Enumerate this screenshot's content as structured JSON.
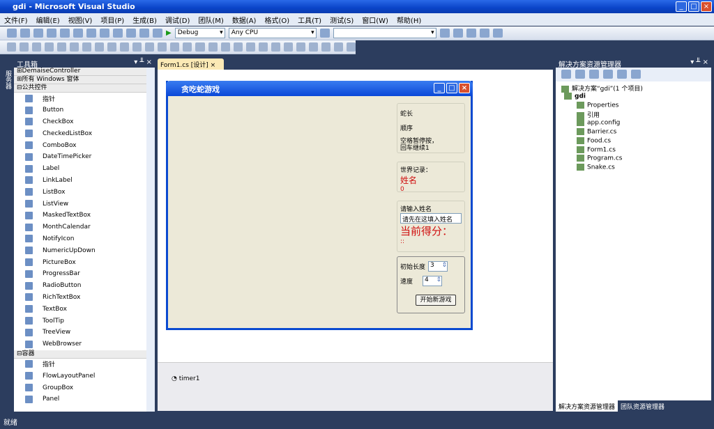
{
  "window": {
    "title": "gdi - Microsoft Visual Studio"
  },
  "menu": [
    "文件(F)",
    "编辑(E)",
    "视图(V)",
    "项目(P)",
    "生成(B)",
    "调试(D)",
    "团队(M)",
    "数据(A)",
    "格式(O)",
    "工具(T)",
    "测试(S)",
    "窗口(W)",
    "帮助(H)"
  ],
  "toolbar": {
    "config": "Debug",
    "platform": "Any CPU",
    "find": ""
  },
  "toolbox": {
    "title": "工具箱",
    "groups_top": [
      "DemaiseController",
      "所有 Windows 窗体",
      "公共控件"
    ],
    "common": [
      "指针",
      "Button",
      "CheckBox",
      "CheckedListBox",
      "ComboBox",
      "DateTimePicker",
      "Label",
      "LinkLabel",
      "ListBox",
      "ListView",
      "MaskedTextBox",
      "MonthCalendar",
      "NotifyIcon",
      "NumericUpDown",
      "PictureBox",
      "ProgressBar",
      "RadioButton",
      "RichTextBox",
      "TextBox",
      "ToolTip",
      "TreeView",
      "WebBrowser"
    ],
    "container_group": "容器",
    "containers": [
      "指针",
      "FlowLayoutPanel",
      "GroupBox",
      "Panel"
    ]
  },
  "leftstrip": "服务器",
  "doc": {
    "tab": "Form1.cs [设计]",
    "close": "×",
    "tray_item": "timer1"
  },
  "form": {
    "title": "贪吃蛇游戏",
    "snake_len": "蛇长",
    "order": "顺序",
    "hint": "空格暂停按，回车继续1",
    "record_label": "世界记录：",
    "record_name": "姓名",
    "record_score": "0",
    "name_prompt": "请输入姓名",
    "name_input": "请先在这填入姓名",
    "score_label": "当前得分：",
    "score_value": "::",
    "init_len_label": "初始长度",
    "init_len": "3",
    "speed_label": "速度",
    "speed": "4",
    "start": "开始新游戏"
  },
  "solution": {
    "title": "解决方案资源管理器",
    "items": [
      "解决方案“gdi”(1 个项目)",
      "gdi",
      "Properties",
      "引用",
      "app.config",
      "Barrier.cs",
      "Food.cs",
      "Form1.cs",
      "Program.cs",
      "Snake.cs"
    ],
    "tabs": [
      "解决方案资源管理器",
      "团队资源管理器"
    ]
  },
  "status": "就绪"
}
